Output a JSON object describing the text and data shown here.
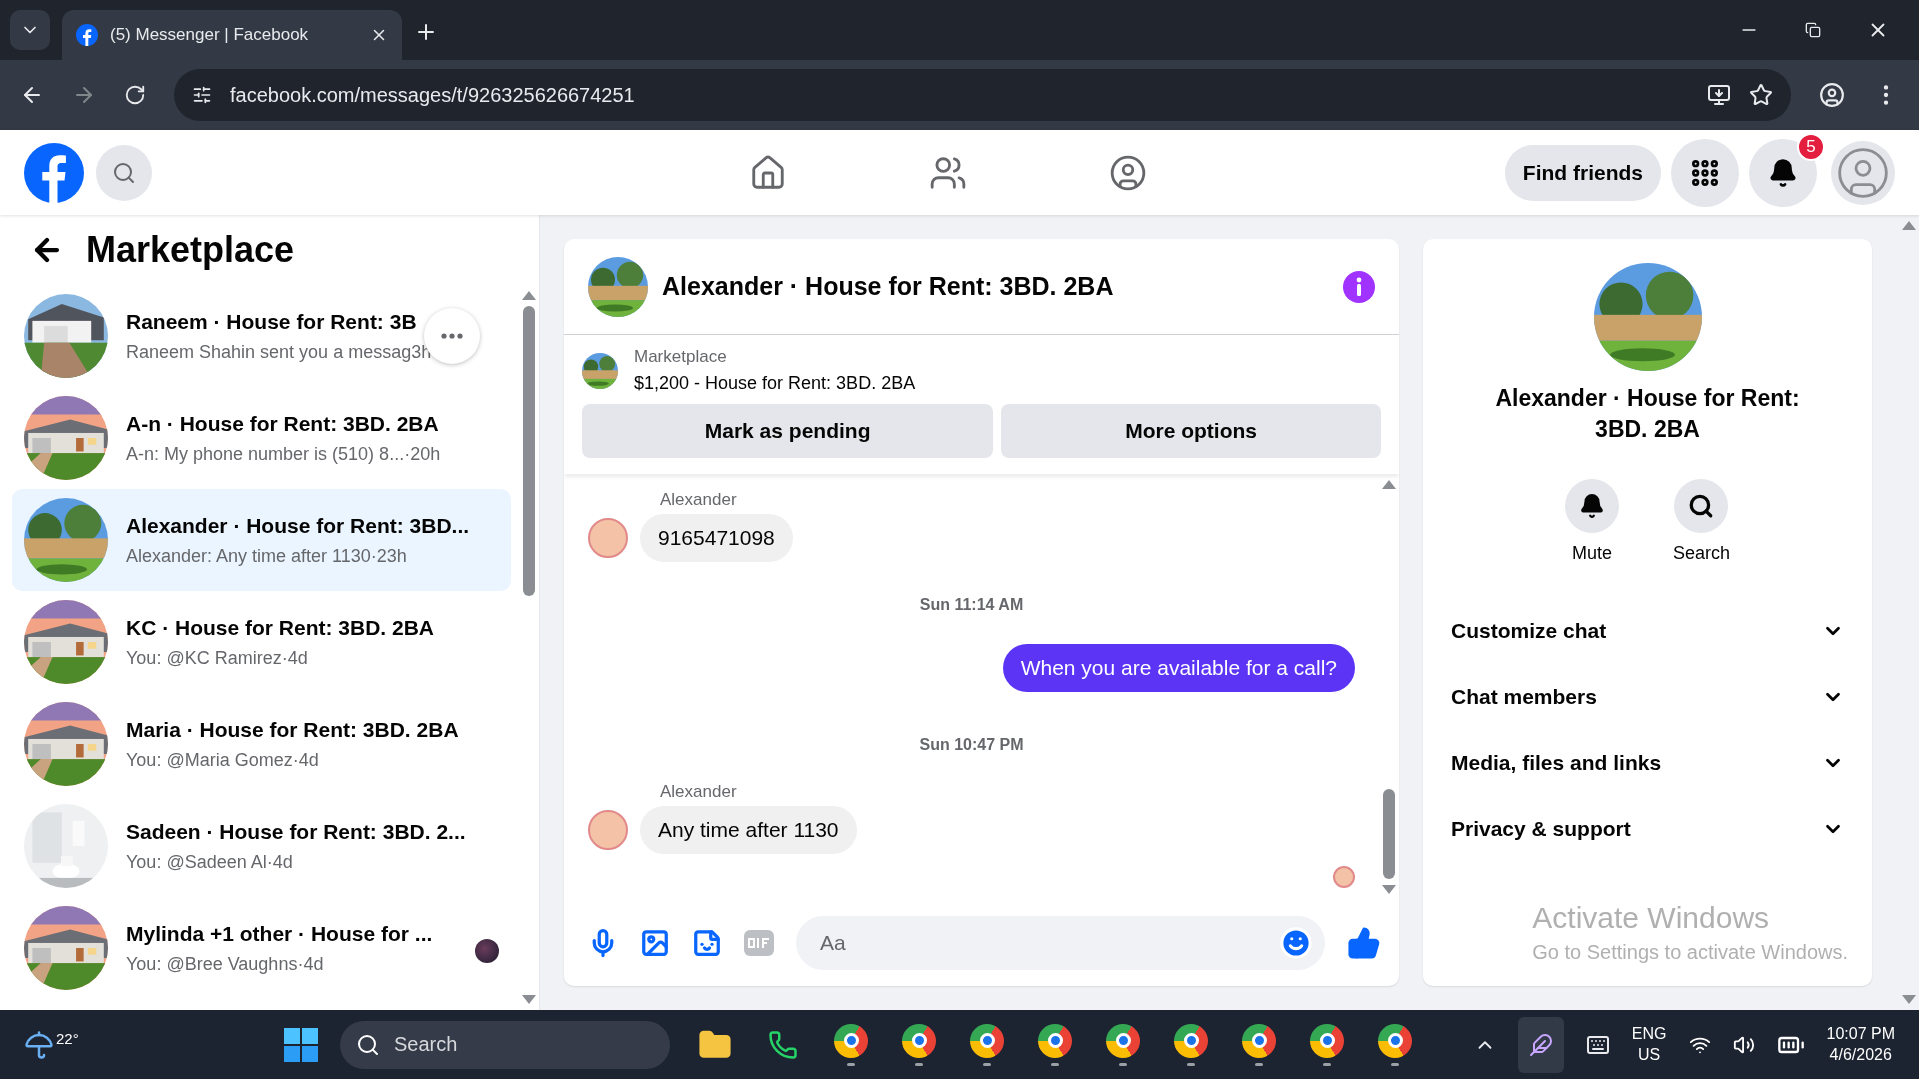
{
  "browser": {
    "tab_title": "(5) Messenger | Facebook",
    "url": "facebook.com/messages/t/926325626674251"
  },
  "header": {
    "find_friends": "Find friends",
    "notifications_badge": "5"
  },
  "sidebar": {
    "title": "Marketplace",
    "conversations": [
      {
        "title": "Raneem · House for Rent: 3B",
        "preview": "Raneem Shahin sent you a messag",
        "time": "3h",
        "selected": false,
        "hovered": true,
        "seen_avatar": false
      },
      {
        "title": "A-n · House for Rent: 3BD. 2BA",
        "preview": "A-n: My phone number is (510) 8...",
        "time": " ·20h",
        "selected": false,
        "hovered": false,
        "seen_avatar": false
      },
      {
        "title": "Alexander · House for Rent: 3BD...",
        "preview": "Alexander: Any time after 1130",
        "time": "·23h",
        "selected": true,
        "hovered": false,
        "seen_avatar": false
      },
      {
        "title": "KC · House for Rent: 3BD. 2BA",
        "preview": "You: @KC Ramirez",
        "time": "·4d",
        "selected": false,
        "hovered": false,
        "seen_avatar": false
      },
      {
        "title": "Maria · House for Rent: 3BD. 2BA",
        "preview": "You: @Maria Gomez",
        "time": "·4d",
        "selected": false,
        "hovered": false,
        "seen_avatar": false
      },
      {
        "title": "Sadeen · House for Rent: 3BD. 2...",
        "preview": "You: @Sadeen Al",
        "time": "·4d",
        "selected": false,
        "hovered": false,
        "seen_avatar": false
      },
      {
        "title": "Mylinda +1 other · House for ...",
        "preview": "You: @Bree Vaughns",
        "time": "·4d",
        "selected": false,
        "hovered": false,
        "seen_avatar": true
      }
    ]
  },
  "chat": {
    "title": "Alexander · House for Rent: 3BD. 2BA",
    "listing": {
      "label": "Marketplace",
      "text": "$1,200 - House for Rent: 3BD. 2BA"
    },
    "buttons": [
      "Mark as pending",
      "More options"
    ],
    "messages": [
      {
        "kind": "sender",
        "text": "Alexander"
      },
      {
        "kind": "incoming",
        "text": "9165471098"
      },
      {
        "kind": "timestamp",
        "text": "Sun 11:14 AM"
      },
      {
        "kind": "outgoing",
        "text": "When you are available for a call?"
      },
      {
        "kind": "timestamp",
        "text": "Sun 10:47 PM"
      },
      {
        "kind": "sender",
        "text": "Alexander"
      },
      {
        "kind": "incoming",
        "text": "Any time after 1130"
      }
    ],
    "composer": {
      "placeholder": "Aa"
    }
  },
  "details": {
    "title": "Alexander · House for Rent: 3BD. 2BA",
    "actions": [
      {
        "kind": "mute",
        "label": "Mute"
      },
      {
        "kind": "search",
        "label": "Search"
      }
    ],
    "sections": [
      {
        "label": "Customize chat",
        "expanded": false
      },
      {
        "label": "Chat members",
        "expanded": false
      },
      {
        "label": "Media, files and links",
        "expanded": false
      },
      {
        "label": "Privacy & support",
        "expanded": false
      }
    ],
    "activation": {
      "title": "Activate Windows",
      "text": "Go to Settings to activate Windows."
    }
  },
  "taskbar": {
    "temperature": "22°",
    "search": "Search",
    "apps": [
      {
        "kind": "explorer"
      },
      {
        "kind": "whatsapp"
      },
      {
        "kind": "chrome"
      },
      {
        "kind": "chrome"
      },
      {
        "kind": "chrome"
      },
      {
        "kind": "chrome"
      },
      {
        "kind": "chrome"
      },
      {
        "kind": "chrome"
      },
      {
        "kind": "chrome"
      },
      {
        "kind": "chrome"
      },
      {
        "kind": "chrome"
      }
    ],
    "language": "ENG",
    "region": "US",
    "time": "10:07 PM",
    "date": "4/6/2026"
  }
}
